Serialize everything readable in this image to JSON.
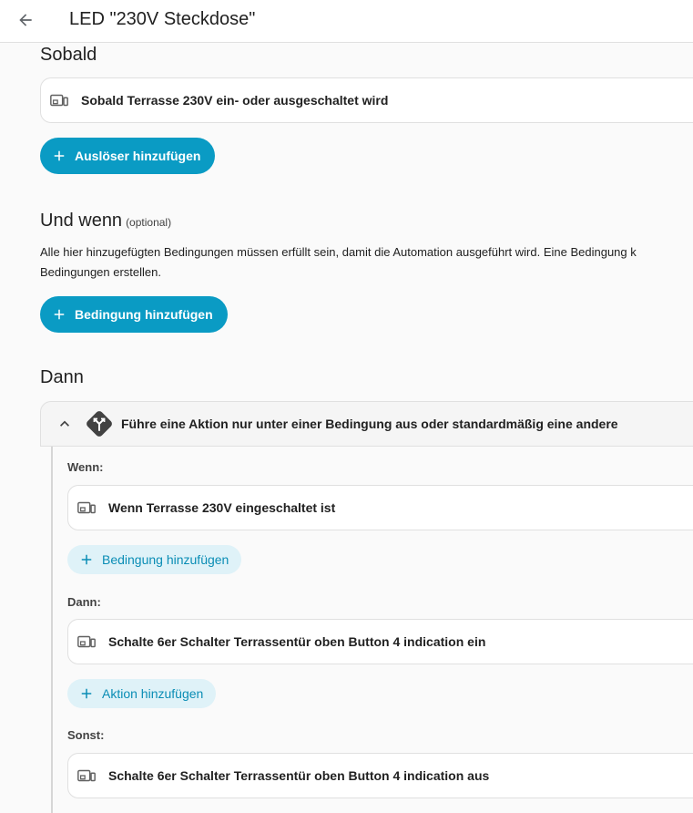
{
  "header": {
    "title": "LED \"230V Steckdose\"",
    "back_icon": "arrow-left-icon"
  },
  "triggers": {
    "section_title": "Sobald",
    "items": [
      {
        "label": "Sobald Terrasse 230V ein- oder ausgeschaltet wird",
        "icon": "device-icon"
      }
    ],
    "add_label": "Auslöser hinzufügen"
  },
  "conditions": {
    "section_title": "Und wenn",
    "optional_label": "(optional)",
    "description_line1": "Alle hier hinzugefügten Bedingungen müssen erfüllt sein, damit die Automation ausgeführt wird. Eine Bedingung k",
    "description_line2": "Bedingungen erstellen.",
    "add_label": "Bedingung hinzufügen"
  },
  "actions": {
    "section_title": "Dann",
    "choose_label": "Führe eine Aktion nur unter einer Bedingung aus oder standardmäßig eine andere",
    "choose_icon": "choose-branch-icon",
    "if_block": {
      "label": "Wenn:",
      "items": [
        {
          "label": "Wenn Terrasse 230V eingeschaltet ist",
          "icon": "device-icon"
        }
      ],
      "add_label": "Bedingung hinzufügen"
    },
    "then_block": {
      "label": "Dann:",
      "items": [
        {
          "label": "Schalte 6er Schalter Terrassentür oben Button 4 indication ein",
          "icon": "device-icon"
        }
      ],
      "add_label": "Aktion hinzufügen"
    },
    "else_block": {
      "label": "Sonst:",
      "items": [
        {
          "label": "Schalte 6er Schalter Terrassentür oben Button 4 indication aus",
          "icon": "device-icon"
        }
      ]
    }
  },
  "colors": {
    "primary": "#0a9bc4",
    "tonal_bg": "#dff2f8",
    "tonal_text": "#0a8db5"
  }
}
